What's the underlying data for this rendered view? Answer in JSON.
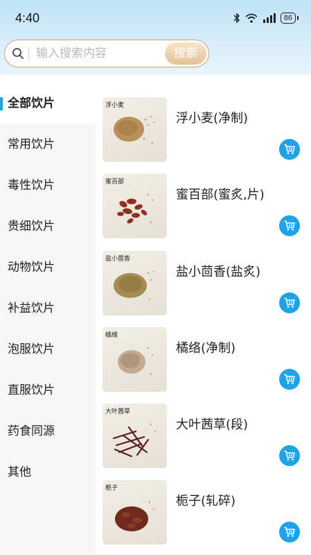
{
  "status_bar": {
    "time": "4:40",
    "battery": "86"
  },
  "search": {
    "placeholder": "输入搜索内容",
    "button_label": "搜索"
  },
  "colors": {
    "accent": "#1fa3e8",
    "active_bar": "#2a9fdd",
    "search_button": "#e3c196"
  },
  "sidebar": {
    "items": [
      {
        "label": "全部饮片",
        "active": true
      },
      {
        "label": "常用饮片"
      },
      {
        "label": "毒性饮片"
      },
      {
        "label": "贵细饮片"
      },
      {
        "label": "动物饮片"
      },
      {
        "label": "补益饮片"
      },
      {
        "label": "泡服饮片"
      },
      {
        "label": "直服饮片"
      },
      {
        "label": "药食同源"
      },
      {
        "label": "其他"
      }
    ]
  },
  "products": [
    {
      "name": "浮小麦(净制)",
      "thumb_label": "浮小麦",
      "icon": "cart-icon"
    },
    {
      "name": "蜜百部(蜜炙,片)",
      "thumb_label": "蜜百部",
      "icon": "cart-icon"
    },
    {
      "name": "盐小茴香(盐炙)",
      "thumb_label": "盐小茴香",
      "icon": "cart-icon"
    },
    {
      "name": "橘络(净制)",
      "thumb_label": "橘络",
      "icon": "cart-icon"
    },
    {
      "name": "大叶茜草(段)",
      "thumb_label": "大叶茜草",
      "icon": "cart-icon"
    },
    {
      "name": "栀子(轧碎)",
      "thumb_label": "栀子",
      "icon": "cart-icon"
    }
  ]
}
